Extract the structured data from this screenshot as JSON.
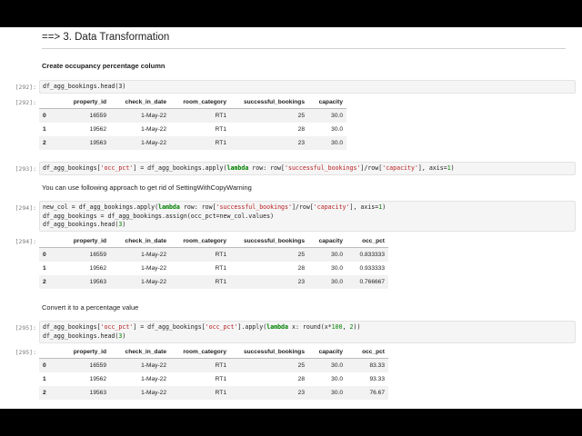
{
  "notebook": {
    "heading": "==> 3. Data Transformation",
    "cells": {
      "md1": "Create occupancy percentage column",
      "in292": {
        "prompt": "[292]:",
        "code": "df_agg_bookings.head(3)"
      },
      "out292": {
        "prompt": "[292]:"
      },
      "in293": {
        "prompt": "[293]:"
      },
      "md2": "You can use following approach to get rid of SettingWithCopyWarning",
      "in294": {
        "prompt": "[294]:"
      },
      "out294": {
        "prompt": "[294]:"
      },
      "md3": "Convert it to a percentage value",
      "in295": {
        "prompt": "[295]:"
      },
      "out295": {
        "prompt": "[295]:"
      }
    },
    "table1": {
      "headers": [
        "",
        "property_id",
        "check_in_date",
        "room_category",
        "successful_bookings",
        "capacity"
      ],
      "rows": [
        [
          "0",
          "16559",
          "1-May-22",
          "RT1",
          "25",
          "30.0"
        ],
        [
          "1",
          "19562",
          "1-May-22",
          "RT1",
          "28",
          "30.0"
        ],
        [
          "2",
          "19563",
          "1-May-22",
          "RT1",
          "23",
          "30.0"
        ]
      ]
    },
    "table2": {
      "headers": [
        "",
        "property_id",
        "check_in_date",
        "room_category",
        "successful_bookings",
        "capacity",
        "occ_pct"
      ],
      "rows": [
        [
          "0",
          "16559",
          "1-May-22",
          "RT1",
          "25",
          "30.0",
          "0.833333"
        ],
        [
          "1",
          "19562",
          "1-May-22",
          "RT1",
          "28",
          "30.0",
          "0.933333"
        ],
        [
          "2",
          "19563",
          "1-May-22",
          "RT1",
          "23",
          "30.0",
          "0.766667"
        ]
      ]
    },
    "table3": {
      "headers": [
        "",
        "property_id",
        "check_in_date",
        "room_category",
        "successful_bookings",
        "capacity",
        "occ_pct"
      ],
      "rows": [
        [
          "0",
          "16559",
          "1-May-22",
          "RT1",
          "25",
          "30.0",
          "83.33"
        ],
        [
          "1",
          "19562",
          "1-May-22",
          "RT1",
          "28",
          "30.0",
          "93.33"
        ],
        [
          "2",
          "19563",
          "1-May-22",
          "RT1",
          "23",
          "30.0",
          "76.67"
        ]
      ]
    }
  }
}
